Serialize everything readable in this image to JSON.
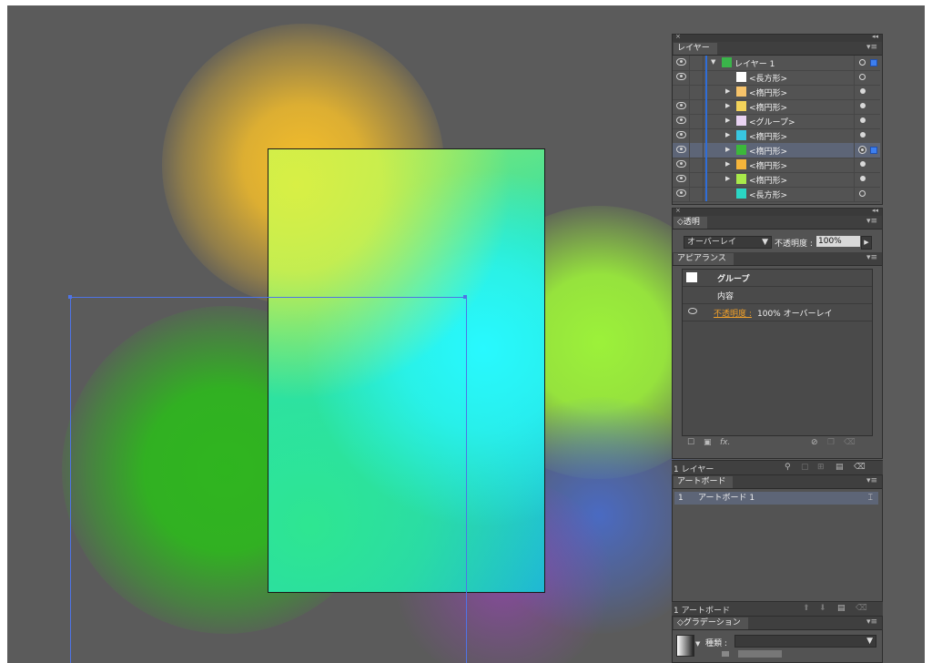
{
  "layers_panel": {
    "tab": "レイヤー",
    "rows": [
      {
        "label": "レイヤー 1",
        "thumb": "#3ab54a",
        "has_arrow": true,
        "expanded": true,
        "visible": true,
        "target": "open",
        "selected_square": true,
        "indent": 0
      },
      {
        "label": "<長方形>",
        "thumb": "#ffffff",
        "has_arrow": false,
        "visible": true,
        "target": "open",
        "indent": 1
      },
      {
        "label": "<楕円形>",
        "thumb": "#f6c36a",
        "has_arrow": true,
        "visible": false,
        "target": "filled",
        "indent": 1
      },
      {
        "label": "<楕円形>",
        "thumb": "#f3d35a",
        "has_arrow": true,
        "visible": true,
        "target": "filled",
        "indent": 1
      },
      {
        "label": "<グループ>",
        "thumb": "#e9d3f2",
        "has_arrow": true,
        "visible": true,
        "target": "filled",
        "indent": 1
      },
      {
        "label": "<楕円形>",
        "thumb": "#38c6e0",
        "has_arrow": true,
        "visible": true,
        "target": "filled",
        "indent": 1
      },
      {
        "label": "<楕円形>",
        "thumb": "#3cb83a",
        "has_arrow": true,
        "visible": true,
        "target": "double",
        "selected": true,
        "selected_square": true,
        "indent": 1
      },
      {
        "label": "<楕円形>",
        "thumb": "#f6b53a",
        "has_arrow": true,
        "visible": true,
        "target": "filled",
        "indent": 1
      },
      {
        "label": "<楕円形>",
        "thumb": "#a8e94a",
        "has_arrow": true,
        "visible": true,
        "target": "filled",
        "indent": 1
      },
      {
        "label": "<長方形>",
        "thumb": "#2bd6c4",
        "has_arrow": false,
        "visible": true,
        "target": "open",
        "indent": 1
      }
    ],
    "footer": "1 レイヤー"
  },
  "transparency_panel": {
    "tab": "透明",
    "blend_mode": "オーバーレイ",
    "opacity_label": "不透明度 :",
    "opacity_value": "100%"
  },
  "appearance_panel": {
    "tab": "アピアランス",
    "group_label": "グループ",
    "contents_label": "内容",
    "opacity_link": "不透明度 :",
    "opacity_detail": "100% オーバーレイ"
  },
  "artboards_panel": {
    "tab": "アートボード",
    "rows": [
      {
        "num": "1",
        "name": "アートボード 1"
      }
    ],
    "footer": "1 アートボード"
  },
  "gradient_panel": {
    "tab": "グラデーション",
    "type_label": "種類 :",
    "type_value": ""
  },
  "colors": {
    "canvas_bg": "#5b5b5b",
    "selection": "#4e74e6",
    "opacity_link": "#f0a02a"
  }
}
